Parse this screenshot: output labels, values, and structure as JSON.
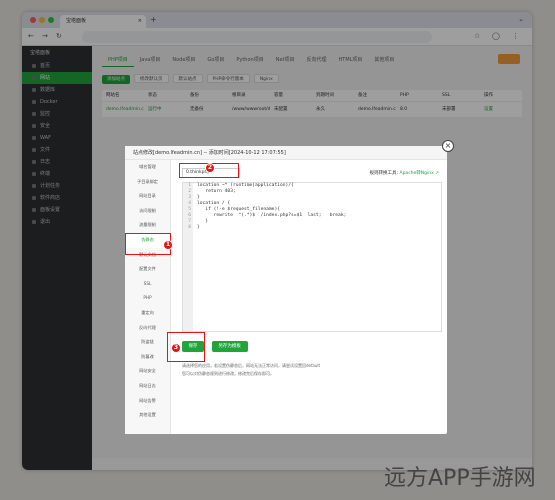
{
  "browser": {
    "tab_title": "宝塔面板",
    "address": "",
    "colors": {
      "close": "#ff5f57",
      "min": "#febc2e",
      "max": "#28c840"
    }
  },
  "sidebar": {
    "logo": "宝塔面板",
    "items": [
      "首页",
      "网站",
      "数据库",
      "Docker",
      "监控",
      "安全",
      "WAF",
      "文件",
      "日志",
      "终端",
      "计划任务",
      "软件商店",
      "面板设置",
      "退出"
    ],
    "active_index": 1
  },
  "main": {
    "tabs": [
      "PHP项目",
      "Java项目",
      "Node项目",
      "Go项目",
      "Python项目",
      "Net项目",
      "反向代理",
      "HTML项目",
      "其他项目"
    ],
    "toolbar": [
      "添加站点",
      "修改默认页",
      "默认站点",
      "PHP命令行版本",
      "Nginx"
    ],
    "table_headers": [
      "网站名",
      "状态",
      "备份",
      "根目录",
      "容量",
      "到期时间",
      "备注",
      "PHP",
      "SSL",
      "操作"
    ],
    "row": [
      "demo.lfeadmin.cn",
      "运行中",
      "无备份",
      "/www/wwwroot/demo",
      "未配置",
      "永久",
      "demo.lfeadmin.cn",
      "8.0",
      "未部署",
      "设置"
    ]
  },
  "modal": {
    "title": "站点修改[demo.lfeadmin.cn] -- 添加时间[2024-10-12 17:07:55]",
    "menu": [
      "域名管理",
      "子目录绑定",
      "网站目录",
      "访问限制",
      "流量限制",
      "伪静态",
      "默认文档",
      "配置文件",
      "SSL",
      "PHP",
      "重定向",
      "反向代理",
      "防盗链",
      "防篡改",
      "网站安全",
      "网站日志",
      "网站告警",
      "其他设置"
    ],
    "active_menu": "伪静态",
    "rule_select": "0.thinkphp",
    "rule_hint": "规则转换工具:",
    "rule_hint_link": "Apache转Nginx",
    "code_lines": [
      "location ~* (runtime|application)/{",
      "   return 403;",
      "}",
      "location / {",
      "   if (!-e $request_filename){",
      "      rewrite  ^(.*)$  /index.php?s=$1  last;   break;",
      "   }",
      "}"
    ],
    "save_button": "保存",
    "template_button": "另存为模板",
    "notes": [
      "请选择您的应用，若设置伪静态后，网站无法正常访问，请尝试设置回default",
      "您可以对伪静态规则进行修改，修改完后保存即可。"
    ]
  },
  "annotations": [
    "1",
    "2",
    "3"
  ],
  "watermark": "远方APP手游网"
}
